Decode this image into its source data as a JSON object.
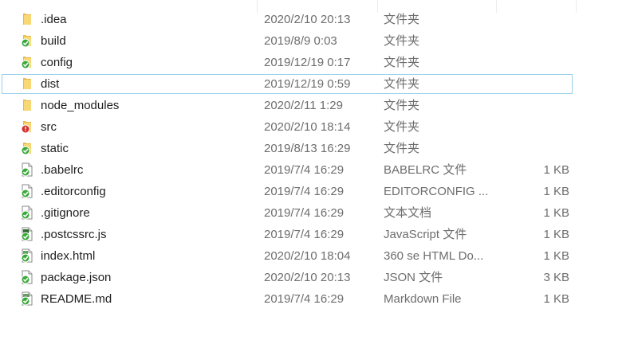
{
  "files": [
    {
      "name": ".idea",
      "date": "2020/2/10 20:13",
      "type": "文件夹",
      "size": "",
      "icon": "folder-icon"
    },
    {
      "name": "build",
      "date": "2019/8/9 0:03",
      "type": "文件夹",
      "size": "",
      "icon": "folder-synced-icon"
    },
    {
      "name": "config",
      "date": "2019/12/19 0:17",
      "type": "文件夹",
      "size": "",
      "icon": "folder-synced-icon"
    },
    {
      "name": "dist",
      "date": "2019/12/19 0:59",
      "type": "文件夹",
      "size": "",
      "icon": "folder-icon"
    },
    {
      "name": "node_modules",
      "date": "2020/2/11 1:29",
      "type": "文件夹",
      "size": "",
      "icon": "folder-icon"
    },
    {
      "name": "src",
      "date": "2020/2/10 18:14",
      "type": "文件夹",
      "size": "",
      "icon": "folder-modified-icon"
    },
    {
      "name": "static",
      "date": "2019/8/13 16:29",
      "type": "文件夹",
      "size": "",
      "icon": "folder-synced-icon"
    },
    {
      "name": ".babelrc",
      "date": "2019/7/4 16:29",
      "type": "BABELRC 文件",
      "size": "1 KB",
      "icon": "file-synced-icon"
    },
    {
      "name": ".editorconfig",
      "date": "2019/7/4 16:29",
      "type": "EDITORCONFIG ...",
      "size": "1 KB",
      "icon": "file-synced-icon"
    },
    {
      "name": ".gitignore",
      "date": "2019/7/4 16:29",
      "type": "文本文档",
      "size": "1 KB",
      "icon": "text-file-synced-icon"
    },
    {
      "name": ".postcssrc.js",
      "date": "2019/7/4 16:29",
      "type": "JavaScript 文件",
      "size": "1 KB",
      "icon": "js-file-synced-icon"
    },
    {
      "name": "index.html",
      "date": "2020/2/10 18:04",
      "type": "360 se HTML Do...",
      "size": "1 KB",
      "icon": "html-file-synced-icon"
    },
    {
      "name": "package.json",
      "date": "2020/2/10 20:13",
      "type": "JSON 文件",
      "size": "3 KB",
      "icon": "file-synced-icon"
    },
    {
      "name": "README.md",
      "date": "2019/7/4 16:29",
      "type": "Markdown File",
      "size": "1 KB",
      "icon": "markdown-file-synced-icon"
    }
  ],
  "selected_index": 3,
  "colors": {
    "folder": "#f8d775",
    "folder_dark": "#e8b94a",
    "synced": "#3aa83a",
    "modified": "#d32f2f",
    "selection_border": "#99d1ea"
  }
}
